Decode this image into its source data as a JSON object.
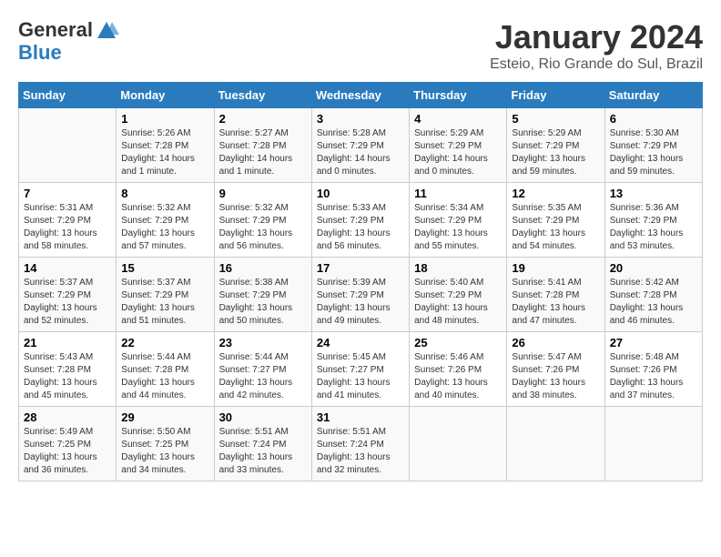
{
  "logo": {
    "general": "General",
    "blue": "Blue"
  },
  "title": "January 2024",
  "subtitle": "Esteio, Rio Grande do Sul, Brazil",
  "days_header": [
    "Sunday",
    "Monday",
    "Tuesday",
    "Wednesday",
    "Thursday",
    "Friday",
    "Saturday"
  ],
  "weeks": [
    [
      {
        "day": "",
        "sunrise": "",
        "sunset": "",
        "daylight": ""
      },
      {
        "day": "1",
        "sunrise": "Sunrise: 5:26 AM",
        "sunset": "Sunset: 7:28 PM",
        "daylight": "Daylight: 14 hours and 1 minute."
      },
      {
        "day": "2",
        "sunrise": "Sunrise: 5:27 AM",
        "sunset": "Sunset: 7:28 PM",
        "daylight": "Daylight: 14 hours and 1 minute."
      },
      {
        "day": "3",
        "sunrise": "Sunrise: 5:28 AM",
        "sunset": "Sunset: 7:29 PM",
        "daylight": "Daylight: 14 hours and 0 minutes."
      },
      {
        "day": "4",
        "sunrise": "Sunrise: 5:29 AM",
        "sunset": "Sunset: 7:29 PM",
        "daylight": "Daylight: 14 hours and 0 minutes."
      },
      {
        "day": "5",
        "sunrise": "Sunrise: 5:29 AM",
        "sunset": "Sunset: 7:29 PM",
        "daylight": "Daylight: 13 hours and 59 minutes."
      },
      {
        "day": "6",
        "sunrise": "Sunrise: 5:30 AM",
        "sunset": "Sunset: 7:29 PM",
        "daylight": "Daylight: 13 hours and 59 minutes."
      }
    ],
    [
      {
        "day": "7",
        "sunrise": "Sunrise: 5:31 AM",
        "sunset": "Sunset: 7:29 PM",
        "daylight": "Daylight: 13 hours and 58 minutes."
      },
      {
        "day": "8",
        "sunrise": "Sunrise: 5:32 AM",
        "sunset": "Sunset: 7:29 PM",
        "daylight": "Daylight: 13 hours and 57 minutes."
      },
      {
        "day": "9",
        "sunrise": "Sunrise: 5:32 AM",
        "sunset": "Sunset: 7:29 PM",
        "daylight": "Daylight: 13 hours and 56 minutes."
      },
      {
        "day": "10",
        "sunrise": "Sunrise: 5:33 AM",
        "sunset": "Sunset: 7:29 PM",
        "daylight": "Daylight: 13 hours and 56 minutes."
      },
      {
        "day": "11",
        "sunrise": "Sunrise: 5:34 AM",
        "sunset": "Sunset: 7:29 PM",
        "daylight": "Daylight: 13 hours and 55 minutes."
      },
      {
        "day": "12",
        "sunrise": "Sunrise: 5:35 AM",
        "sunset": "Sunset: 7:29 PM",
        "daylight": "Daylight: 13 hours and 54 minutes."
      },
      {
        "day": "13",
        "sunrise": "Sunrise: 5:36 AM",
        "sunset": "Sunset: 7:29 PM",
        "daylight": "Daylight: 13 hours and 53 minutes."
      }
    ],
    [
      {
        "day": "14",
        "sunrise": "Sunrise: 5:37 AM",
        "sunset": "Sunset: 7:29 PM",
        "daylight": "Daylight: 13 hours and 52 minutes."
      },
      {
        "day": "15",
        "sunrise": "Sunrise: 5:37 AM",
        "sunset": "Sunset: 7:29 PM",
        "daylight": "Daylight: 13 hours and 51 minutes."
      },
      {
        "day": "16",
        "sunrise": "Sunrise: 5:38 AM",
        "sunset": "Sunset: 7:29 PM",
        "daylight": "Daylight: 13 hours and 50 minutes."
      },
      {
        "day": "17",
        "sunrise": "Sunrise: 5:39 AM",
        "sunset": "Sunset: 7:29 PM",
        "daylight": "Daylight: 13 hours and 49 minutes."
      },
      {
        "day": "18",
        "sunrise": "Sunrise: 5:40 AM",
        "sunset": "Sunset: 7:29 PM",
        "daylight": "Daylight: 13 hours and 48 minutes."
      },
      {
        "day": "19",
        "sunrise": "Sunrise: 5:41 AM",
        "sunset": "Sunset: 7:28 PM",
        "daylight": "Daylight: 13 hours and 47 minutes."
      },
      {
        "day": "20",
        "sunrise": "Sunrise: 5:42 AM",
        "sunset": "Sunset: 7:28 PM",
        "daylight": "Daylight: 13 hours and 46 minutes."
      }
    ],
    [
      {
        "day": "21",
        "sunrise": "Sunrise: 5:43 AM",
        "sunset": "Sunset: 7:28 PM",
        "daylight": "Daylight: 13 hours and 45 minutes."
      },
      {
        "day": "22",
        "sunrise": "Sunrise: 5:44 AM",
        "sunset": "Sunset: 7:28 PM",
        "daylight": "Daylight: 13 hours and 44 minutes."
      },
      {
        "day": "23",
        "sunrise": "Sunrise: 5:44 AM",
        "sunset": "Sunset: 7:27 PM",
        "daylight": "Daylight: 13 hours and 42 minutes."
      },
      {
        "day": "24",
        "sunrise": "Sunrise: 5:45 AM",
        "sunset": "Sunset: 7:27 PM",
        "daylight": "Daylight: 13 hours and 41 minutes."
      },
      {
        "day": "25",
        "sunrise": "Sunrise: 5:46 AM",
        "sunset": "Sunset: 7:26 PM",
        "daylight": "Daylight: 13 hours and 40 minutes."
      },
      {
        "day": "26",
        "sunrise": "Sunrise: 5:47 AM",
        "sunset": "Sunset: 7:26 PM",
        "daylight": "Daylight: 13 hours and 38 minutes."
      },
      {
        "day": "27",
        "sunrise": "Sunrise: 5:48 AM",
        "sunset": "Sunset: 7:26 PM",
        "daylight": "Daylight: 13 hours and 37 minutes."
      }
    ],
    [
      {
        "day": "28",
        "sunrise": "Sunrise: 5:49 AM",
        "sunset": "Sunset: 7:25 PM",
        "daylight": "Daylight: 13 hours and 36 minutes."
      },
      {
        "day": "29",
        "sunrise": "Sunrise: 5:50 AM",
        "sunset": "Sunset: 7:25 PM",
        "daylight": "Daylight: 13 hours and 34 minutes."
      },
      {
        "day": "30",
        "sunrise": "Sunrise: 5:51 AM",
        "sunset": "Sunset: 7:24 PM",
        "daylight": "Daylight: 13 hours and 33 minutes."
      },
      {
        "day": "31",
        "sunrise": "Sunrise: 5:51 AM",
        "sunset": "Sunset: 7:24 PM",
        "daylight": "Daylight: 13 hours and 32 minutes."
      },
      {
        "day": "",
        "sunrise": "",
        "sunset": "",
        "daylight": ""
      },
      {
        "day": "",
        "sunrise": "",
        "sunset": "",
        "daylight": ""
      },
      {
        "day": "",
        "sunrise": "",
        "sunset": "",
        "daylight": ""
      }
    ]
  ]
}
